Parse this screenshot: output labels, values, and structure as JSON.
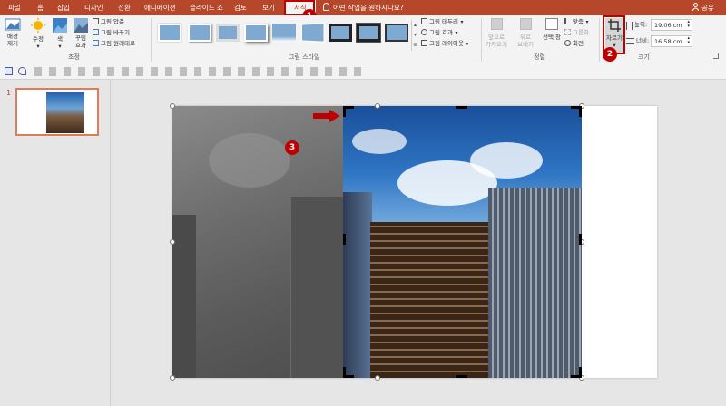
{
  "tabs": [
    "파일",
    "홈",
    "삽입",
    "디자인",
    "전환",
    "애니메이션",
    "슬라이드 쇼",
    "검토",
    "보기",
    "서식"
  ],
  "tell_me": "어떤 작업을 원하시나요?",
  "share": "공유",
  "ribbon": {
    "remove_bg": [
      "배경",
      "제거"
    ],
    "corrections": "수정",
    "color": "색",
    "artistic": [
      "꾸밈",
      "효과"
    ],
    "compress": "그림 압축",
    "change": "그림 바꾸기",
    "reset": "그림 원래대로",
    "group_adjust": "조정",
    "picture_border": "그림 테두리",
    "picture_effects": "그림 효과",
    "picture_layout": "그림 레이아웃",
    "group_styles": "그림 스타일",
    "bring_forward": [
      "앞으로",
      "가져오기"
    ],
    "send_backward": [
      "뒤로",
      "보내기"
    ],
    "selection_pane": "선택 창",
    "align": "맞춤",
    "group": "그룹화",
    "rotate": "회전",
    "group_arrange": "정렬",
    "crop": "자르기",
    "height_label": "높이:",
    "height_value": "19.06 cm",
    "width_label": "너비:",
    "width_value": "16.58 cm",
    "group_size": "크기"
  },
  "slide_number": "1",
  "callouts": [
    "1",
    "2",
    "3"
  ],
  "colors": {
    "accent": "#b7472a",
    "callout": "#c00000"
  },
  "icons": [
    "save-icon",
    "undo-icon",
    "redo-icon",
    "crop-icon",
    "share-icon",
    "lightbulb-icon"
  ]
}
